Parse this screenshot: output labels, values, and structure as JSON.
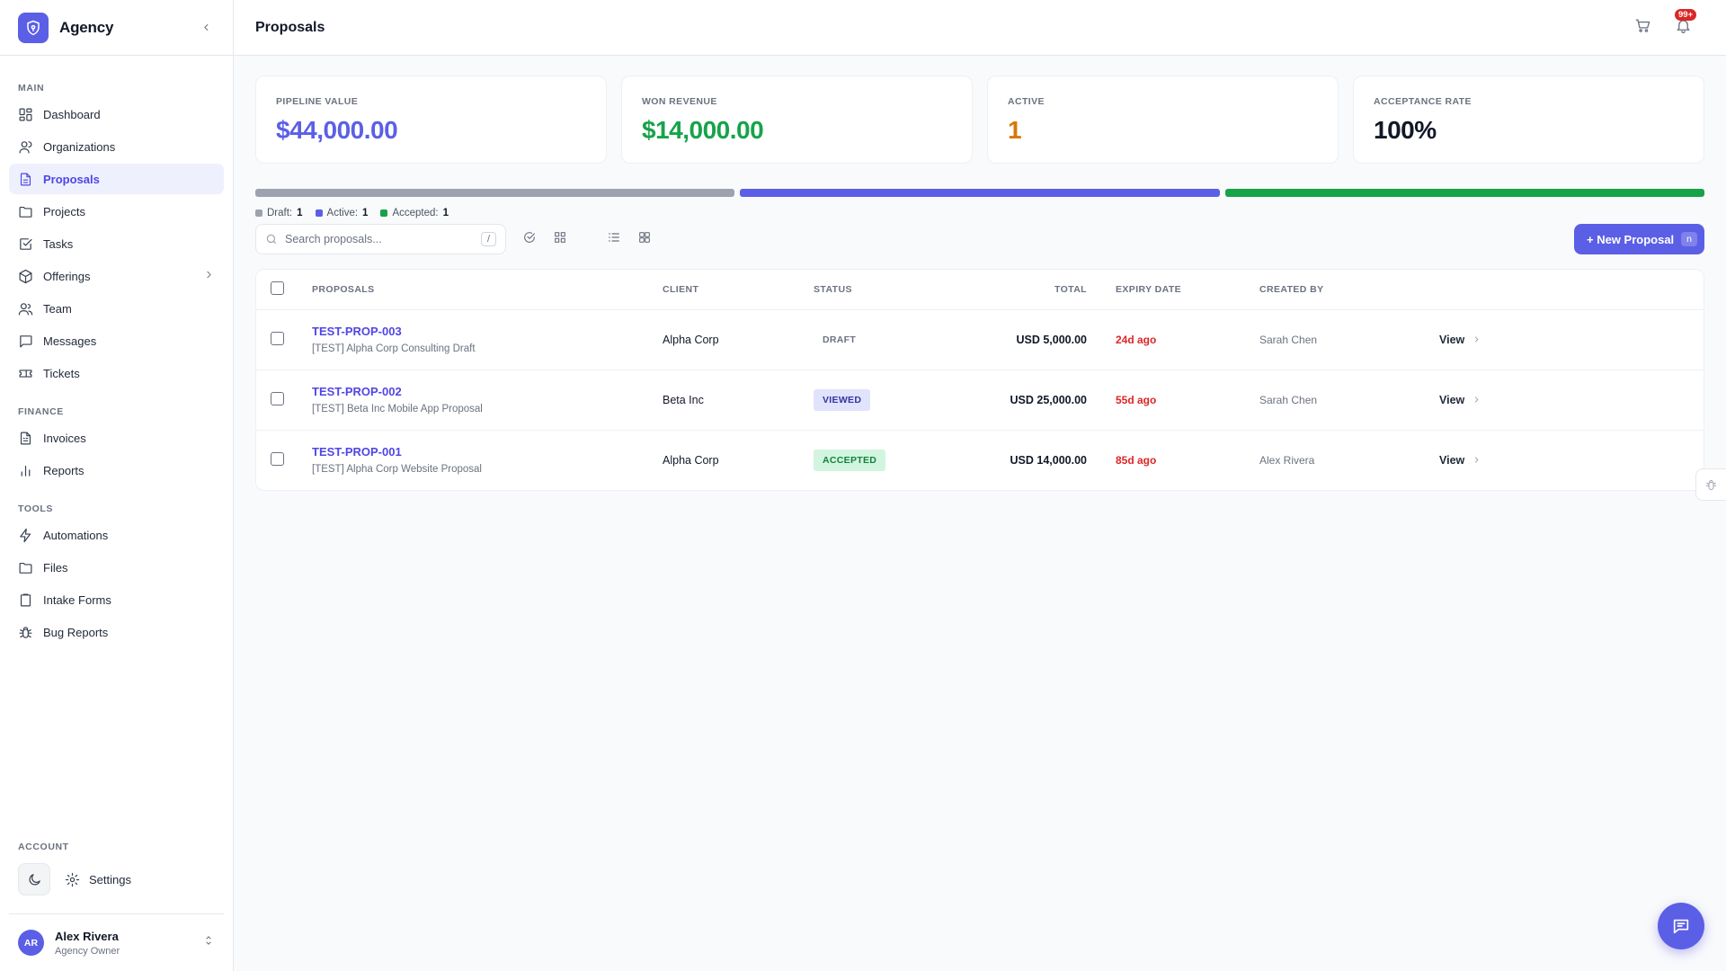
{
  "brand": {
    "name": "Agency"
  },
  "sidebar": {
    "sections": [
      {
        "label": "MAIN",
        "items": [
          {
            "label": "Dashboard",
            "icon": "dashboard-icon"
          },
          {
            "label": "Organizations",
            "icon": "users-icon"
          },
          {
            "label": "Proposals",
            "icon": "document-icon",
            "active": true
          },
          {
            "label": "Projects",
            "icon": "folder-icon"
          },
          {
            "label": "Tasks",
            "icon": "checkbox-icon"
          },
          {
            "label": "Offerings",
            "icon": "box-icon",
            "has_submenu": true
          },
          {
            "label": "Team",
            "icon": "team-icon"
          },
          {
            "label": "Messages",
            "icon": "message-icon"
          },
          {
            "label": "Tickets",
            "icon": "ticket-icon"
          }
        ]
      },
      {
        "label": "FINANCE",
        "items": [
          {
            "label": "Invoices",
            "icon": "invoice-icon"
          },
          {
            "label": "Reports",
            "icon": "bar-chart-icon"
          }
        ]
      },
      {
        "label": "TOOLS",
        "items": [
          {
            "label": "Automations",
            "icon": "lightning-icon"
          },
          {
            "label": "Files",
            "icon": "folder-icon"
          },
          {
            "label": "Intake Forms",
            "icon": "clipboard-icon"
          },
          {
            "label": "Bug Reports",
            "icon": "bug-icon"
          }
        ]
      }
    ],
    "account": {
      "label": "ACCOUNT",
      "settings_label": "Settings"
    },
    "user": {
      "initials": "AR",
      "name": "Alex Rivera",
      "role": "Agency Owner"
    }
  },
  "header": {
    "title": "Proposals",
    "notification_count": "99+"
  },
  "stats": [
    {
      "label": "PIPELINE VALUE",
      "value": "$44,000.00",
      "color": "#5b5fe6"
    },
    {
      "label": "WON REVENUE",
      "value": "$14,000.00",
      "color": "#16a34a"
    },
    {
      "label": "ACTIVE",
      "value": "1",
      "color": "#d97706"
    },
    {
      "label": "ACCEPTANCE RATE",
      "value": "100%",
      "color": "#111827"
    }
  ],
  "pipeline": {
    "segments": [
      {
        "name": "Draft",
        "count": 1,
        "color": "#9ca3af"
      },
      {
        "name": "Active",
        "count": 1,
        "color": "#5b5fe6"
      },
      {
        "name": "Accepted",
        "count": 1,
        "color": "#16a34a"
      }
    ],
    "legend": [
      {
        "label": "Draft:",
        "count": "1",
        "color": "#9ca3af"
      },
      {
        "label": "Active:",
        "count": "1",
        "color": "#5b5fe6"
      },
      {
        "label": "Accepted:",
        "count": "1",
        "color": "#16a34a"
      }
    ]
  },
  "toolbar": {
    "search_placeholder": "Search proposals...",
    "search_shortcut": "/",
    "new_label": "+ New Proposal",
    "new_shortcut": "n"
  },
  "table": {
    "headers": {
      "proposals": "PROPOSALS",
      "client": "CLIENT",
      "status": "STATUS",
      "total": "TOTAL",
      "expiry": "EXPIRY DATE",
      "created_by": "CREATED BY"
    },
    "rows": [
      {
        "id": "TEST-PROP-003",
        "name": "[TEST] Alpha Corp Consulting Draft",
        "client": "Alpha Corp",
        "status": "DRAFT",
        "status_kind": "draft",
        "total": "USD 5,000.00",
        "expiry": "24d ago",
        "created_by": "Sarah Chen",
        "action": "View"
      },
      {
        "id": "TEST-PROP-002",
        "name": "[TEST] Beta Inc Mobile App Proposal",
        "client": "Beta Inc",
        "status": "VIEWED",
        "status_kind": "viewed",
        "total": "USD 25,000.00",
        "expiry": "55d ago",
        "created_by": "Sarah Chen",
        "action": "View"
      },
      {
        "id": "TEST-PROP-001",
        "name": "[TEST] Alpha Corp Website Proposal",
        "client": "Alpha Corp",
        "status": "ACCEPTED",
        "status_kind": "accepted",
        "total": "USD 14,000.00",
        "expiry": "85d ago",
        "created_by": "Alex Rivera",
        "action": "View"
      }
    ]
  }
}
